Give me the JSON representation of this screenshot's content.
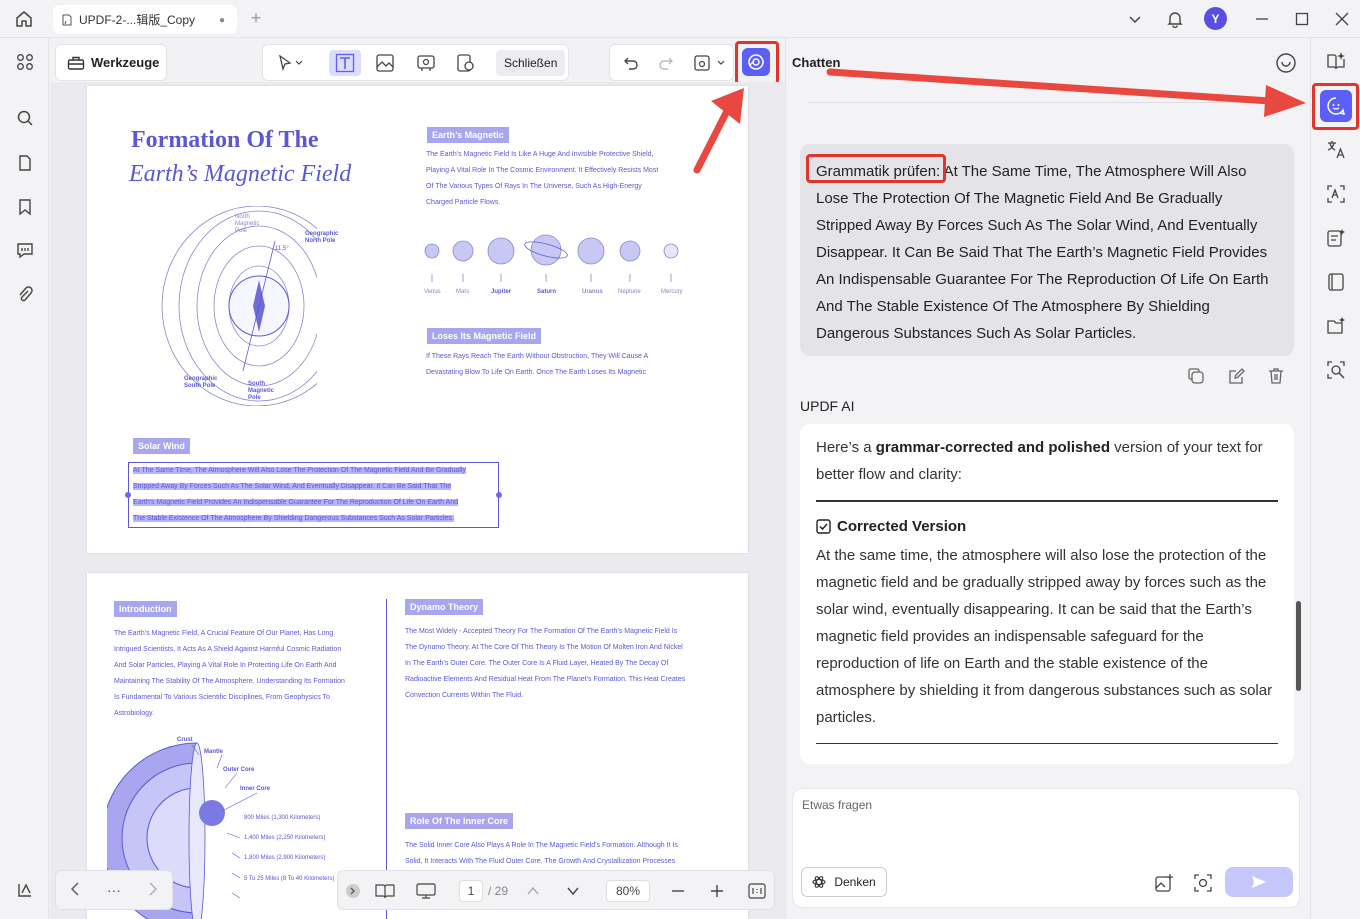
{
  "titlebar": {
    "tab_title": "UPDF-2-...辑版_Copy",
    "avatar_letter": "Y"
  },
  "toolbar": {
    "tools_label": "Werkzeuge",
    "close_label": "Schließen"
  },
  "document": {
    "page1": {
      "title_line1": "Formation Of The",
      "title_line2": "Earth’s Magnetic Field",
      "earths_magnetic_label": "Earth’s Magnetic",
      "earths_magnetic_text": [
        "The Earth’s Magnetic Field Is Like A Huge And Invisible Protective Shield,",
        "Playing A Vital Role In The Cosmic Environment. It Effectively Resists Most",
        "Of The Various Types Of Rays In The Universe, Such As High-Energy",
        "Charged Particle Flows."
      ],
      "planets": [
        "Venus",
        "Mars",
        "Jupiter",
        "Saturn",
        "Uranus",
        "Neptune",
        "Mercury"
      ],
      "loses_label": "Loses Its Magnetic Field",
      "loses_text": [
        "If These Rays Reach The Earth Without Obstruction, They Will Cause A",
        "Devastating Blow To Life On Earth. Once The Earth Loses Its Magnetic"
      ],
      "diagram_labels": {
        "north_magnetic_pole": "North Magnetic Pole",
        "geographic_north_pole": "Geographic North Pole",
        "geographic_south_pole": "Geographic South Pole",
        "south_magnetic_pole": "South Magnetic Pole",
        "angle": "11.5°"
      },
      "solar_wind_label": "Solar Wind",
      "solar_wind_text": [
        "At The Same Time, The Atmosphere Will Also Lose The Protection Of The Magnetic Field And Be Gradually",
        "Stripped Away By Forces Such As The Solar Wind, And Eventually Disappear. It Can Be Said That The",
        "Earth’s Magnetic Field Provides An Indispensable Guarantee For The Reproduction Of Life On Earth And",
        "The Stable Existence Of The Atmosphere By Shielding Dangerous Substances Such As Solar Particles."
      ]
    },
    "page2": {
      "intro_label": "Introduction",
      "intro_text": [
        "The Earth’s Magnetic Field, A Crucial Feature Of Our Planet, Has Long",
        "Intrigued Scientists. It Acts As A Shield Against Harmful Cosmic Radiation",
        "And Solar Particles, Playing A Vital Role In Protecting Life On Earth And",
        "Maintaining The Stability Of The Atmosphere. Understanding Its Formation",
        "Is Fundamental To Various Scientific Disciplines, From Geophysics To",
        "Astrobiology."
      ],
      "dynamo_label": "Dynamo Theory",
      "dynamo_text": [
        "The Most Widely - Accepted Theory For The Formation Of The Earth’s Magnetic Field Is",
        "The Dynamo Theory. At The Core Of This Theory Is The Motion Of Molten Iron And Nickel",
        "In The Earth’s Outer Core. The Outer Core Is A Fluid Layer, Heated By The Decay Of",
        "Radioactive Elements And Residual Heat From The Planet’s Formation. This Heat Creates",
        "Convection Currents Within The Fluid."
      ],
      "layers": [
        "Crust",
        "Mantle",
        "Outer Core",
        "Inner Core"
      ],
      "depths": [
        "800 Miles (1,300 Kilometers)",
        "1,400 Miles (2,250 Kilometers)",
        "1,800 Miles (2,900 Kilometers)",
        "5 To 25 Miles (8 To 40 Kilometers)"
      ],
      "inner_core_label": "Role Of The Inner Core",
      "inner_core_text": [
        "The Solid Inner Core Also Plays A Role In The Magnetic Field’s Formation. Although It Is",
        "Solid, It Interacts With The Fluid Outer Core. The Growth And Crystallization Processes"
      ]
    }
  },
  "navbar": {
    "more": "···",
    "current_page": "1",
    "total_pages": "/ 29",
    "zoom": "80%"
  },
  "chat": {
    "title": "Chatten",
    "user_message_prefix": "Grammatik prüfen:",
    "user_message": " At The Same Time, The Atmosphere Will Also Lose The Protection Of The Magnetic Field And Be Gradually Stripped Away By Forces Such As The Solar Wind, And Eventually Disappear. It Can Be Said That The Earth’s Magnetic Field Provides An Indispensable Guarantee For The Reproduction Of Life On Earth And The Stable Existence Of The Atmosphere By Shielding Dangerous Substances Such As Solar Particles.",
    "ai_name": "UPDF AI",
    "ai_intro_a": "Here’s a ",
    "ai_intro_bold": "grammar-corrected and polished",
    "ai_intro_b": " version of your text for better flow and clarity:",
    "corrected_title": "Corrected Version",
    "corrected_text": "At the same time, the atmosphere will also lose the protection of the magnetic field and be gradually stripped away by forces such as the solar wind, eventually disappearing. It can be said that the Earth’s magnetic field provides an indispensable safeguard for the reproduction of life on Earth and the stable existence of the atmosphere by shielding it from dangerous substances such as solar particles.",
    "input_placeholder": "Etwas fragen",
    "think_label": "Denken"
  },
  "colors": {
    "accent": "#5b5ff5",
    "highlight": "#e0352f",
    "doc_blue": "#5b58d2"
  }
}
